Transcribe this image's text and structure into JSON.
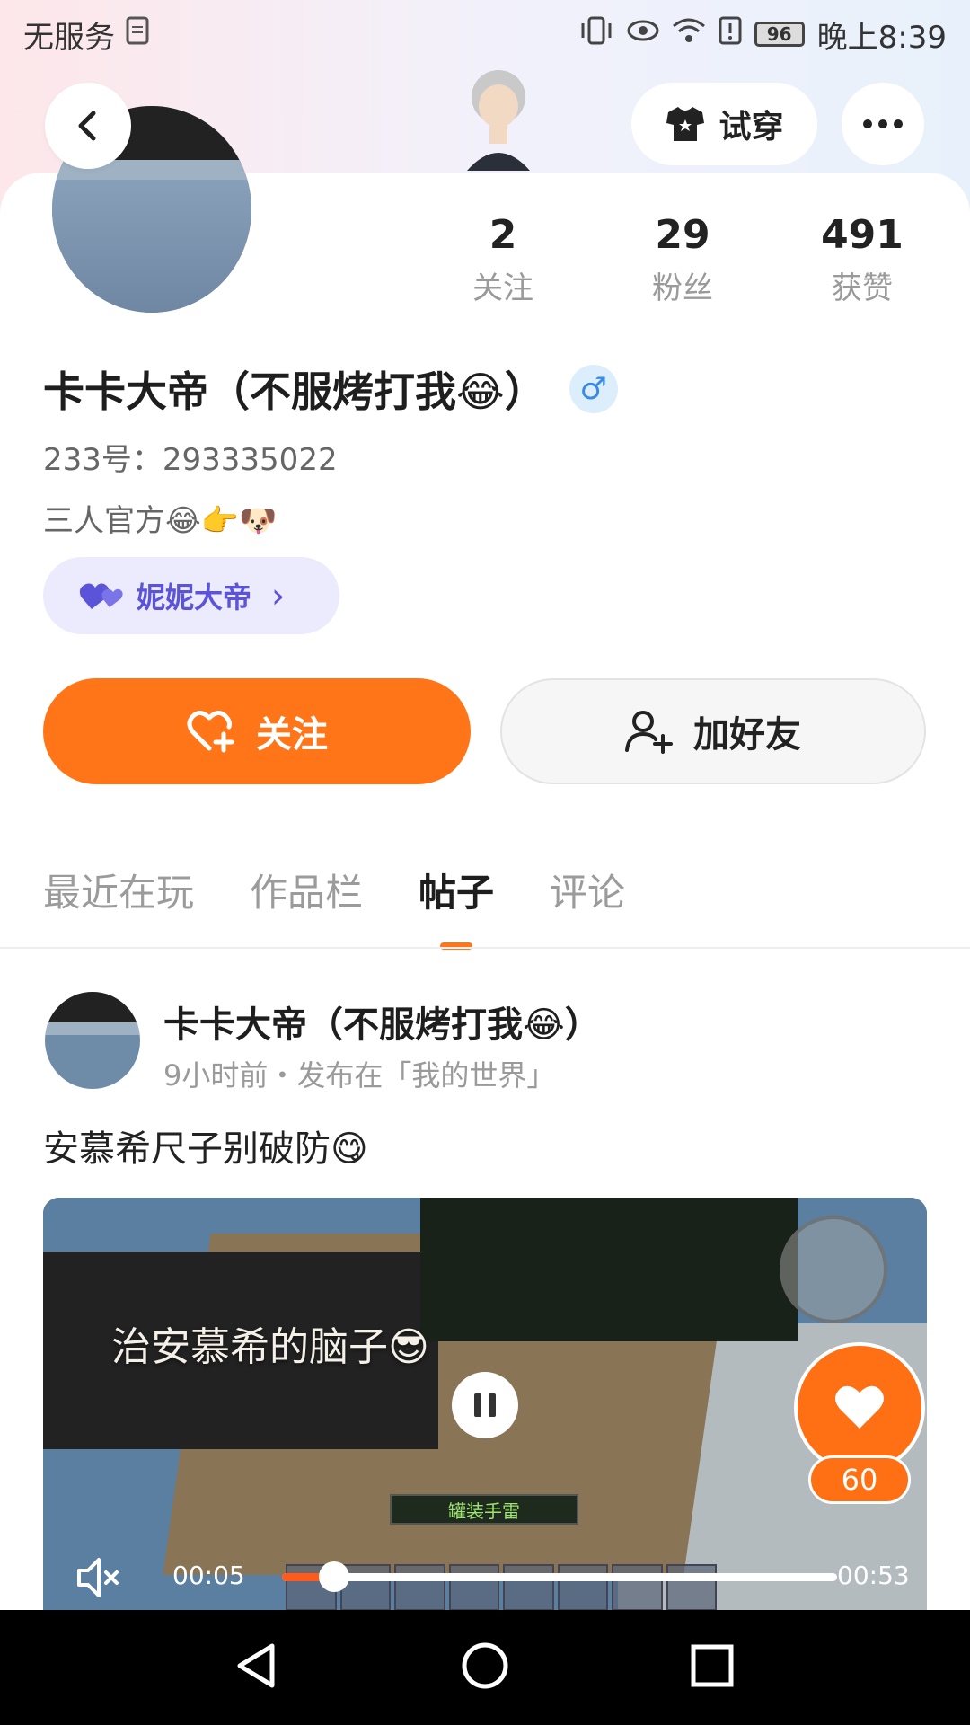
{
  "status_bar": {
    "carrier": "无服务",
    "battery": "96",
    "time": "晚上8:39"
  },
  "header": {
    "try_on_label": "试穿"
  },
  "profile": {
    "stats": [
      {
        "num": "2",
        "label": "关注"
      },
      {
        "num": "29",
        "label": "粉丝"
      },
      {
        "num": "491",
        "label": "获赞"
      }
    ],
    "name": "卡卡大帝（不服烤打我😂）",
    "gender_symbol": "♂",
    "uid": "233号：293335022",
    "bio": "三人官方😂👉🐶",
    "relation_label": "妮妮大帝",
    "relation_arrow": "›",
    "follow_label": "关注",
    "add_friend_label": "加好友"
  },
  "tabs": [
    "最近在玩",
    "作品栏",
    "帖子",
    "评论"
  ],
  "post": {
    "author": "卡卡大帝（不服烤打我😂）",
    "meta": "9小时前・发布在「我的世界」",
    "text": "安慕希尺子别破防😋",
    "video": {
      "caption": "治安慕希的脑子😎",
      "game_label": "罐装手雷",
      "current_time": "00:05",
      "total_time": "00:53",
      "progress": 0.094
    },
    "like_count": "60"
  },
  "colors": {
    "accent": "#ff7517",
    "relation": "#5b54d8"
  }
}
